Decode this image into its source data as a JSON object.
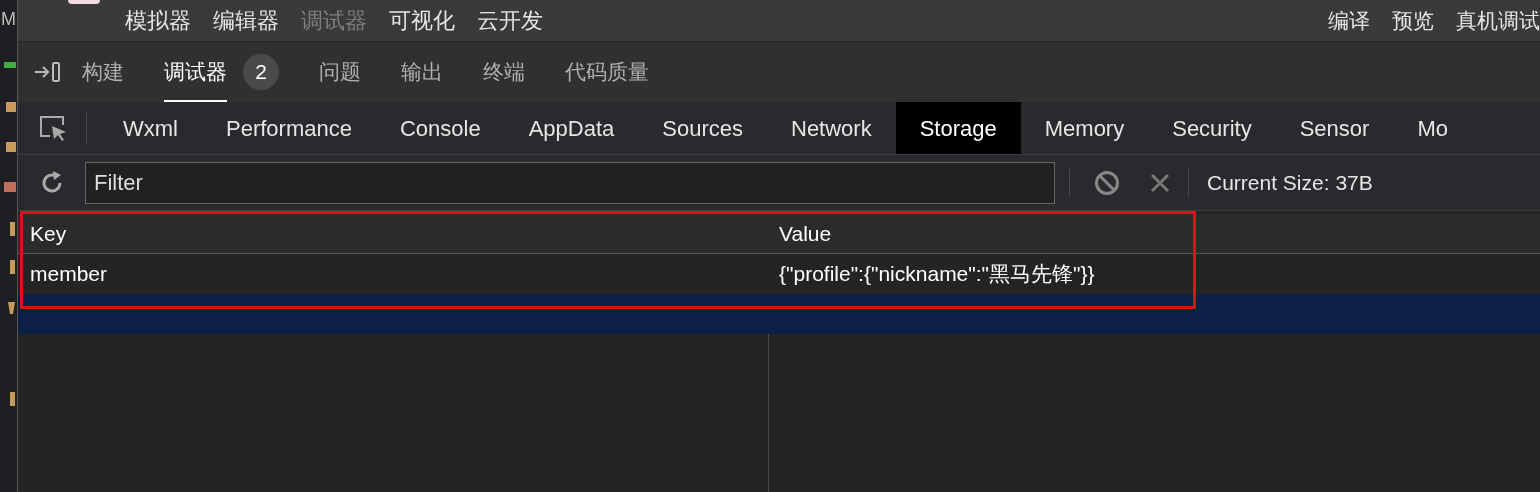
{
  "sidebar": {
    "letter": "M"
  },
  "toolbar": {
    "items": [
      {
        "label": "模拟器",
        "disabled": false
      },
      {
        "label": "编辑器",
        "disabled": false
      },
      {
        "label": "调试器",
        "disabled": true
      },
      {
        "label": "可视化",
        "disabled": false
      },
      {
        "label": "云开发",
        "disabled": false
      }
    ],
    "actions": [
      {
        "label": "编译"
      },
      {
        "label": "预览"
      },
      {
        "label": "真机调试"
      }
    ]
  },
  "panel_tabs": [
    {
      "label": "构建",
      "selected": false
    },
    {
      "label": "调试器",
      "selected": true,
      "badge": "2"
    },
    {
      "label": "问题",
      "selected": false
    },
    {
      "label": "输出",
      "selected": false
    },
    {
      "label": "终端",
      "selected": false
    },
    {
      "label": "代码质量",
      "selected": false
    }
  ],
  "devtools_tabs": [
    {
      "label": "Wxml",
      "selected": false
    },
    {
      "label": "Performance",
      "selected": false
    },
    {
      "label": "Console",
      "selected": false
    },
    {
      "label": "AppData",
      "selected": false
    },
    {
      "label": "Sources",
      "selected": false
    },
    {
      "label": "Network",
      "selected": false
    },
    {
      "label": "Storage",
      "selected": true
    },
    {
      "label": "Memory",
      "selected": false
    },
    {
      "label": "Security",
      "selected": false
    },
    {
      "label": "Sensor",
      "selected": false
    },
    {
      "label": "Mo",
      "selected": false
    }
  ],
  "filter": {
    "placeholder": "Filter"
  },
  "current_size": "Current Size: 37B",
  "table": {
    "columns": [
      "Key",
      "Value"
    ],
    "rows": [
      {
        "key": "member",
        "value": "{\"profile\":{\"nickname\":\"黑马先锋\"}}",
        "selected": false
      },
      {
        "selected": true
      }
    ]
  }
}
